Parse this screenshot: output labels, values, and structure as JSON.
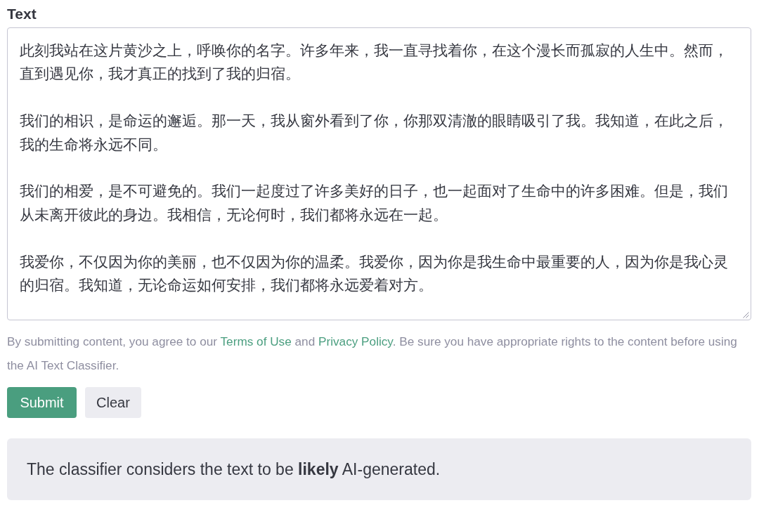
{
  "text_field": {
    "label": "Text",
    "paragraphs": [
      "此刻我站在这片黄沙之上，呼唤你的名字。许多年来，我一直寻找着你，在这个漫长而孤寂的人生中。然而，直到遇见你，我才真正的找到了我的归宿。",
      "我们的相识，是命运的邂逅。那一天，我从窗外看到了你，你那双清澈的眼睛吸引了我。我知道，在此之后，我的生命将永远不同。",
      "我们的相爱，是不可避免的。我们一起度过了许多美好的日子，也一起面对了生命中的许多困难。但是，我们从未离开彼此的身边。我相信，无论何时，我们都将永远在一起。",
      "我爱你，不仅因为你的美丽，也不仅因为你的温柔。我爱你，因为你是我生命中最重要的人，因为你是我心灵的归宿。我知道，无论命运如何安排，我们都将永远爱着对方。"
    ]
  },
  "notice": [
    {
      "kind": "text",
      "text": "By submitting content, you agree to our "
    },
    {
      "kind": "link",
      "text": "Terms of Use"
    },
    {
      "kind": "text",
      "text": " and "
    },
    {
      "kind": "link",
      "text": "Privacy Policy"
    },
    {
      "kind": "text",
      "text": ". Be sure you have appropriate rights to the content before using the AI Text Classifier."
    }
  ],
  "buttons": [
    {
      "label": "Submit",
      "kind": "primary"
    },
    {
      "label": "Clear",
      "kind": "secondary"
    }
  ],
  "result": {
    "message": "The classifier considers the text to be **likely** AI-generated."
  }
}
